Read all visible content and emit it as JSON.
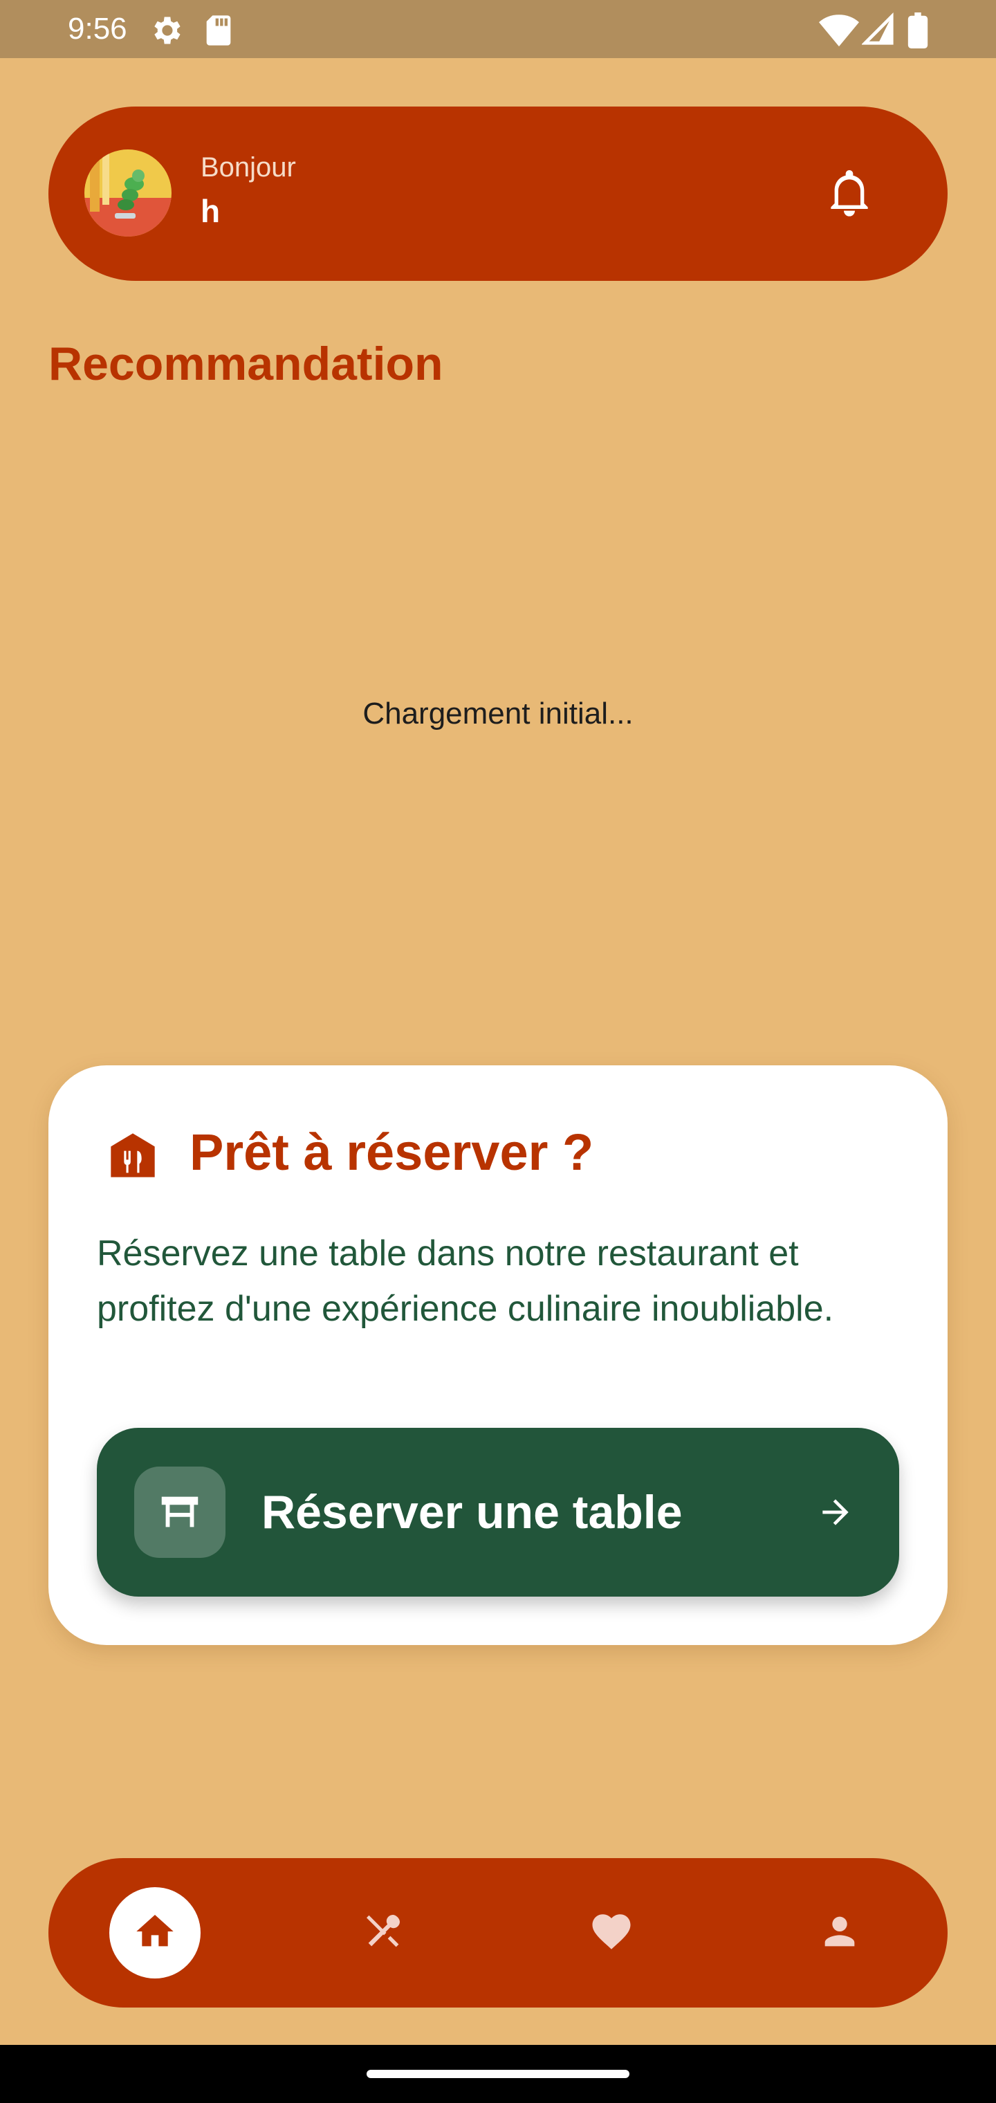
{
  "status_bar": {
    "time": "9:56",
    "icons": [
      "settings-icon",
      "sd-card-icon",
      "wifi-icon",
      "signal-icon",
      "battery-icon"
    ]
  },
  "header": {
    "greeting": "Bonjour",
    "username": "h",
    "bell_icon": "notifications-bell-icon"
  },
  "section": {
    "title": "Recommandation"
  },
  "loading": {
    "text": "Chargement initial..."
  },
  "reserve_card": {
    "icon": "restaurant-building-icon",
    "title": "Prêt à réserver ?",
    "description": "Réservez une table dans notre restaurant et profitez d'une expérience culinaire inoubliable.",
    "button_label": "Réserver une table",
    "button_icon": "table-icon",
    "button_arrow": "arrow-right-icon"
  },
  "bottom_nav": {
    "items": [
      {
        "name": "home",
        "icon": "home-icon",
        "active": true
      },
      {
        "name": "menu",
        "icon": "utensils-icon",
        "active": false
      },
      {
        "name": "favorites",
        "icon": "heart-icon",
        "active": false
      },
      {
        "name": "profile",
        "icon": "person-icon",
        "active": false
      }
    ]
  },
  "colors": {
    "background": "#e8b976",
    "primary": "#b83300",
    "accent_green": "#22553a",
    "status_bar": "#b18e5d",
    "card": "#ffffff"
  }
}
